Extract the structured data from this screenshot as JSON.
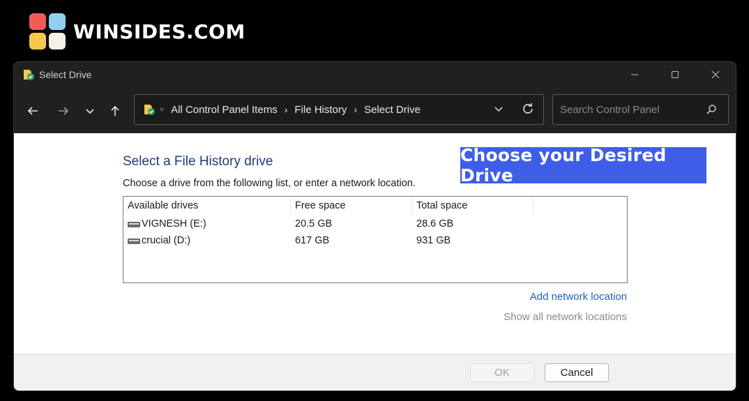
{
  "brand": {
    "name": "WINSIDES.COM"
  },
  "window": {
    "title": "Select Drive",
    "controls": [
      "minimize",
      "maximize",
      "close"
    ]
  },
  "nav": {
    "breadcrumbs": [
      "All Control Panel Items",
      "File History",
      "Select Drive"
    ],
    "search_placeholder": "Search Control Panel"
  },
  "content": {
    "heading": "Select a File History drive",
    "subtext": "Choose a drive from the following list, or enter a network location.",
    "badge": "Choose your Desired Drive",
    "table": {
      "headers": [
        "Available drives",
        "Free space",
        "Total space"
      ],
      "rows": [
        {
          "name": "VIGNESH (E:)",
          "free": "20.5 GB",
          "total": "28.6 GB"
        },
        {
          "name": "crucial (D:)",
          "free": "617 GB",
          "total": "931 GB"
        }
      ]
    },
    "link_add": "Add network location",
    "link_show": "Show all network locations"
  },
  "footer": {
    "ok_label": "OK",
    "cancel_label": "Cancel"
  },
  "colors": {
    "badge": "#3f5ee8",
    "heading": "#1e3c78",
    "link": "#1f5fbf"
  }
}
